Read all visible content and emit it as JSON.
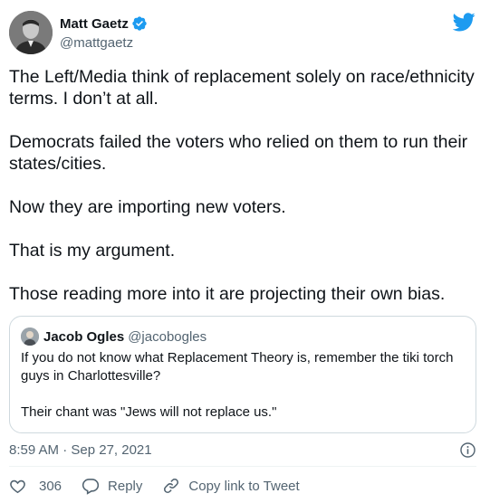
{
  "author": {
    "display_name": "Matt Gaetz",
    "handle": "@mattgaetz"
  },
  "tweet": {
    "paragraphs": [
      "The Left/Media think of replacement solely on race/ethnicity terms. I don’t at all.",
      "Democrats failed the voters who relied on them to run their states/cities.",
      "Now they are importing new voters.",
      "That is my argument.",
      "Those reading more into it are projecting their own bias."
    ]
  },
  "quoted": {
    "display_name": "Jacob Ogles",
    "handle": "@jacobogles",
    "paragraphs": [
      "If you do not know what Replacement Theory is, remember the tiki torch guys in Charlottesville?",
      "Their chant was \"Jews will not replace us.\""
    ]
  },
  "timestamp": "8:59 AM · Sep 27, 2021",
  "actions": {
    "like_count": "306",
    "reply_label": "Reply",
    "copy_link_label": "Copy link to Tweet"
  },
  "icons": {
    "verified": "verified-badge-icon",
    "brand": "twitter-bird-icon",
    "info": "info-icon",
    "like": "heart-icon",
    "reply": "speech-bubble-icon",
    "link": "link-icon"
  },
  "colors": {
    "brand_blue": "#1d9bf0",
    "text": "#0f1419",
    "muted": "#536471",
    "border": "#cfd9de"
  }
}
